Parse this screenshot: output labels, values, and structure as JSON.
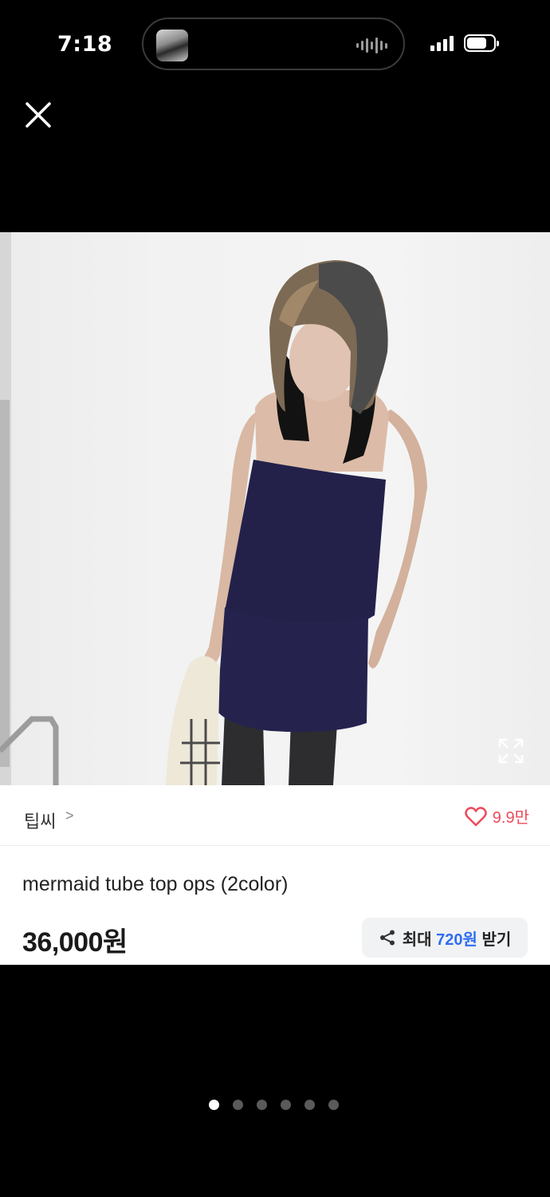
{
  "status_bar": {
    "time": "7:18",
    "icons": [
      "now-playing-thumbnail",
      "audio-waveform-icon",
      "cellular-signal-icon",
      "battery-icon"
    ]
  },
  "toolbar": {
    "close_icon": "close-icon"
  },
  "product": {
    "shop_name": "팁씨",
    "shop_chevron": ">",
    "likes": "9.9만",
    "title": "mermaid tube top ops (2color)",
    "price": "36,000원",
    "reward": {
      "prefix": "최대",
      "amount": "720원",
      "suffix": "받기"
    }
  },
  "gallery": {
    "image_count": 6,
    "active_index": 0
  },
  "colors": {
    "accent_blue": "#2f6df2",
    "like_red": "#ee4a5b",
    "background": "#000000"
  }
}
